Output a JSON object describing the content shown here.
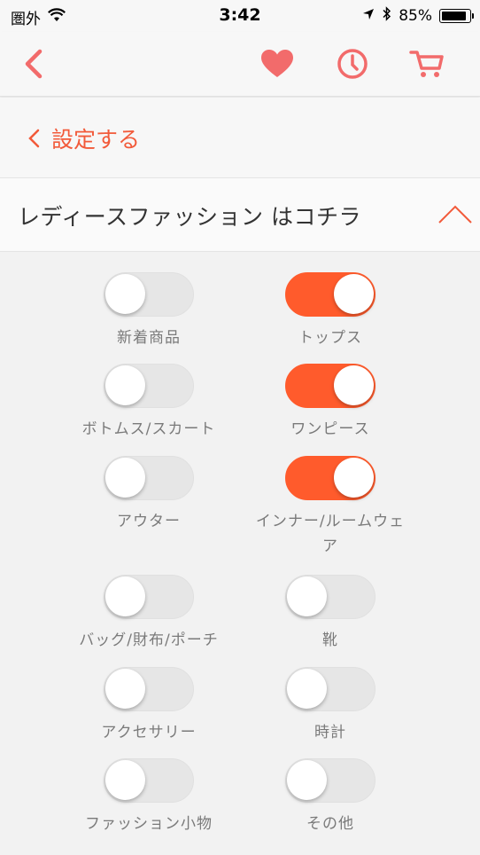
{
  "status_bar": {
    "carrier": "圏外",
    "time": "3:42",
    "battery": "85%"
  },
  "nav": {
    "icons": [
      "back-chevron-icon",
      "heart-icon",
      "clock-icon",
      "cart-icon"
    ]
  },
  "settings": {
    "link_label": "設定する"
  },
  "section": {
    "title": "レディースファッション はコチラ"
  },
  "toggles": [
    {
      "label": "新着商品",
      "on": false
    },
    {
      "label": "トップス",
      "on": true
    },
    {
      "label": "ボトムス/スカート",
      "on": false
    },
    {
      "label": "ワンピース",
      "on": true
    },
    {
      "label": "アウター",
      "on": false
    },
    {
      "label_line1": "インナー/ルームウェ",
      "label_line2": "ア",
      "on": true
    },
    {
      "label": "バッグ/財布/ポーチ",
      "on": false
    },
    {
      "label": "靴",
      "on": false
    },
    {
      "label": "アクセサリー",
      "on": false
    },
    {
      "label": "時計",
      "on": false
    },
    {
      "label": "ファッション小物",
      "on": false
    },
    {
      "label": "その他",
      "on": false
    }
  ],
  "colors": {
    "accent": "#ff5b2c",
    "icon_pink": "#f26b6b",
    "link": "#f25a3a"
  }
}
